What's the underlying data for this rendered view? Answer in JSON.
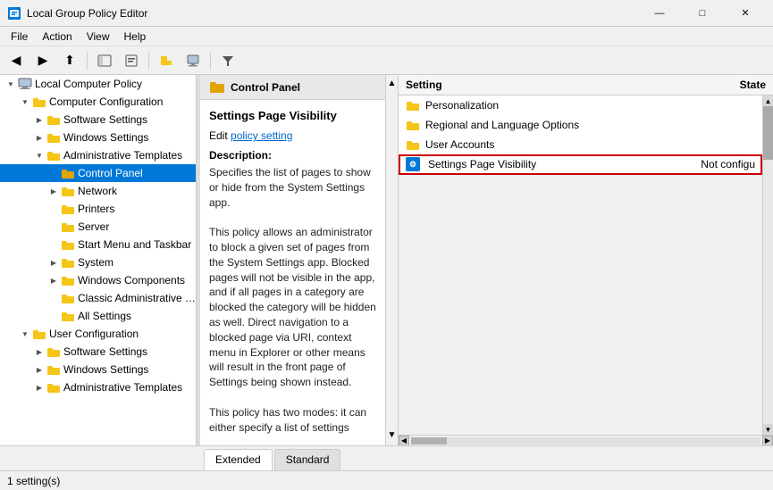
{
  "window": {
    "title": "Local Group Policy Editor",
    "icon": "⚙"
  },
  "menubar": {
    "items": [
      "File",
      "Action",
      "View",
      "Help"
    ]
  },
  "toolbar": {
    "buttons": [
      "◀",
      "▶",
      "⬆",
      "📁",
      "📋",
      "🔄",
      "❌",
      "🔎"
    ]
  },
  "tree": {
    "items": [
      {
        "label": "Local Computer Policy",
        "level": 0,
        "expanded": true,
        "icon": "computer",
        "hasExpand": false
      },
      {
        "label": "Computer Configuration",
        "level": 1,
        "expanded": true,
        "icon": "computer",
        "hasExpand": true
      },
      {
        "label": "Software Settings",
        "level": 2,
        "expanded": false,
        "icon": "folder",
        "hasExpand": true
      },
      {
        "label": "Windows Settings",
        "level": 2,
        "expanded": false,
        "icon": "folder",
        "hasExpand": true
      },
      {
        "label": "Administrative Templates",
        "level": 2,
        "expanded": true,
        "icon": "folder",
        "hasExpand": true
      },
      {
        "label": "Control Panel",
        "level": 3,
        "expanded": false,
        "icon": "folder",
        "hasExpand": false,
        "selected": true
      },
      {
        "label": "Network",
        "level": 3,
        "expanded": false,
        "icon": "folder",
        "hasExpand": true
      },
      {
        "label": "Printers",
        "level": 3,
        "expanded": false,
        "icon": "folder",
        "hasExpand": false
      },
      {
        "label": "Server",
        "level": 3,
        "expanded": false,
        "icon": "folder",
        "hasExpand": false
      },
      {
        "label": "Start Menu and Taskbar",
        "level": 3,
        "expanded": false,
        "icon": "folder",
        "hasExpand": false
      },
      {
        "label": "System",
        "level": 3,
        "expanded": false,
        "icon": "folder",
        "hasExpand": true
      },
      {
        "label": "Windows Components",
        "level": 3,
        "expanded": false,
        "icon": "folder",
        "hasExpand": true
      },
      {
        "label": "Classic Administrative Tem...",
        "level": 3,
        "expanded": false,
        "icon": "folder",
        "hasExpand": false
      },
      {
        "label": "All Settings",
        "level": 3,
        "expanded": false,
        "icon": "folder",
        "hasExpand": false
      },
      {
        "label": "User Configuration",
        "level": 1,
        "expanded": true,
        "icon": "computer",
        "hasExpand": true
      },
      {
        "label": "Software Settings",
        "level": 2,
        "expanded": false,
        "icon": "folder",
        "hasExpand": true
      },
      {
        "label": "Windows Settings",
        "level": 2,
        "expanded": false,
        "icon": "folder",
        "hasExpand": true
      },
      {
        "label": "Administrative Templates",
        "level": 2,
        "expanded": false,
        "icon": "folder",
        "hasExpand": true
      }
    ]
  },
  "desc_panel": {
    "header": "Control Panel",
    "title": "Settings Page Visibility",
    "edit_label": "Edit",
    "policy_link": "policy setting",
    "description_label": "Description:",
    "description_text": "Specifies the list of pages to show or hide from the System Settings app.\n\nThis policy allows an administrator to block a given set of pages from the System Settings app. Blocked pages will not be visible in the app, and if all pages in a category are blocked the category will be hidden as well. Direct navigation to a blocked page via URI, context menu in Explorer or other means will result in the front page of Settings being shown instead.\n\nThis policy has two modes: it can either specify a list of settings"
  },
  "settings_panel": {
    "col_setting": "Setting",
    "col_state": "State",
    "groups": [
      {
        "label": "Personalization",
        "icon": "folder"
      },
      {
        "label": "Regional and Language Options",
        "icon": "folder"
      },
      {
        "label": "User Accounts",
        "icon": "folder"
      }
    ],
    "rows": [
      {
        "label": "Settings Page Visibility",
        "state": "Not configu",
        "icon": "policy",
        "selected": true
      }
    ]
  },
  "tabs": {
    "items": [
      "Extended",
      "Standard"
    ],
    "active": "Extended"
  },
  "status_bar": {
    "text": "1 setting(s)"
  }
}
